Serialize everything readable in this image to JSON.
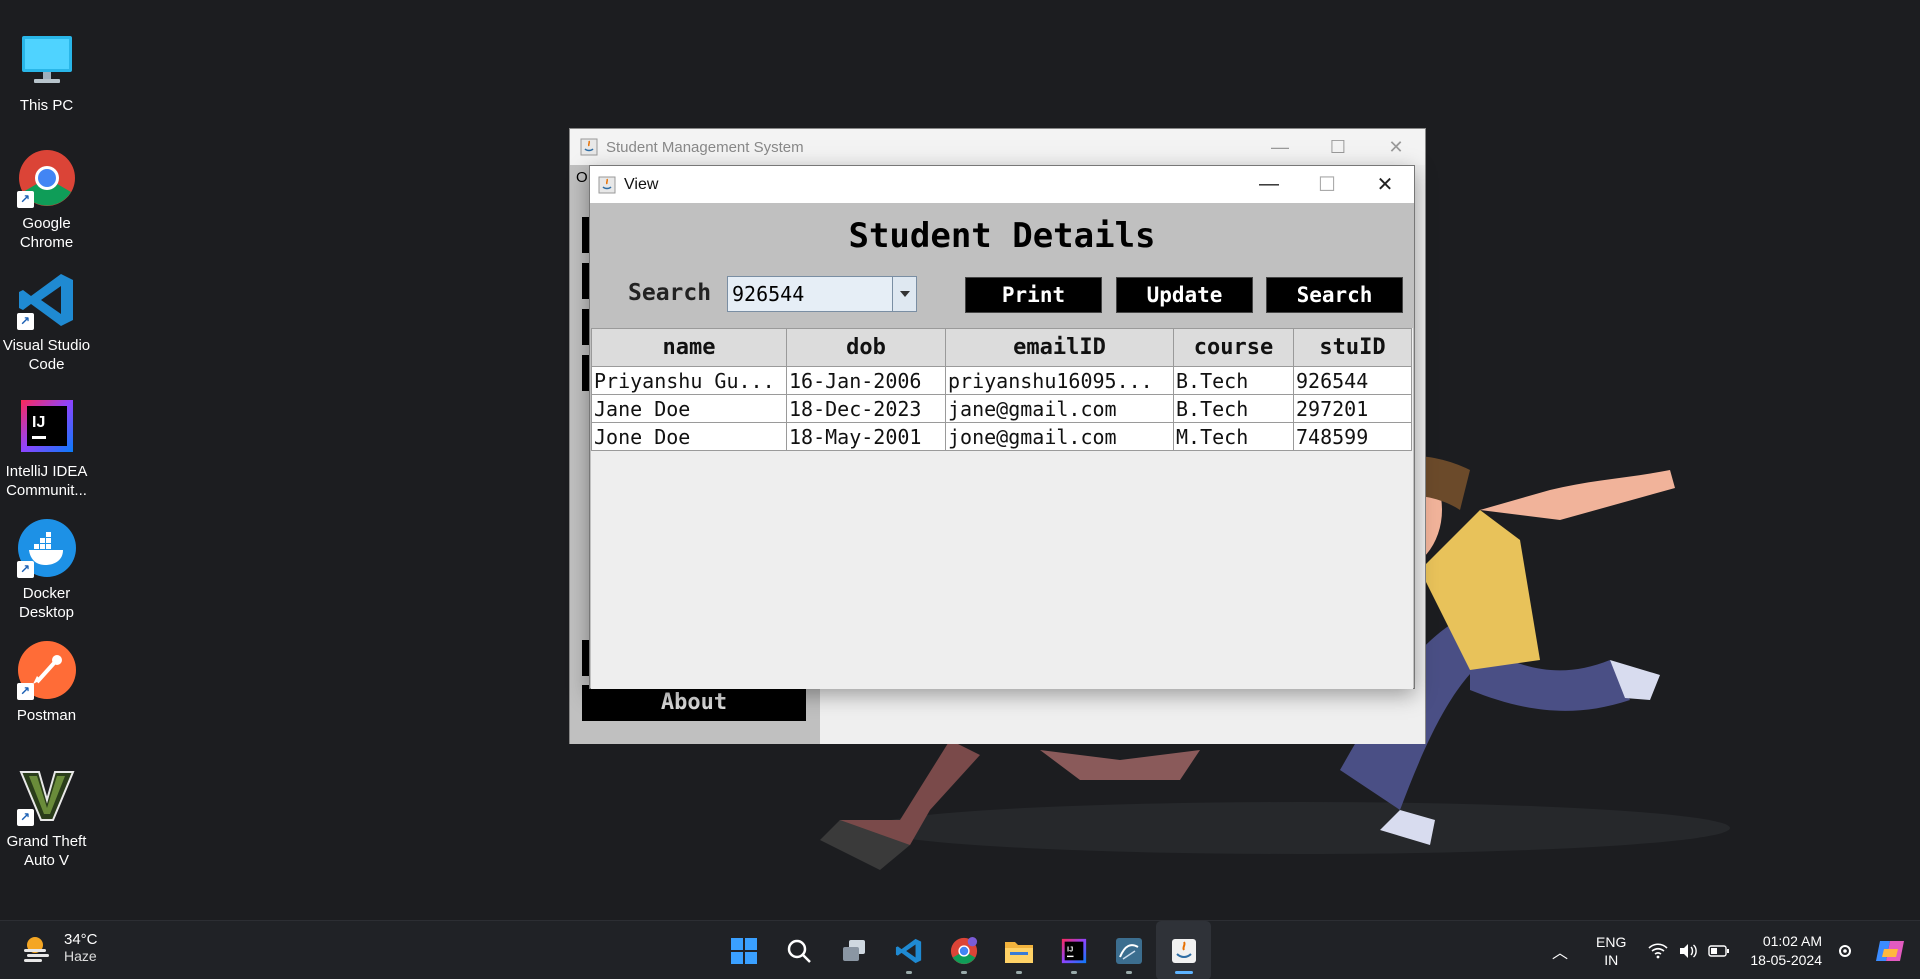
{
  "desktop": {
    "icons": [
      {
        "label": "This PC"
      },
      {
        "label": "Google Chrome"
      },
      {
        "label": "Visual Studio Code"
      },
      {
        "label": "IntelliJ IDEA Communit..."
      },
      {
        "label": "Docker Desktop"
      },
      {
        "label": "Postman"
      },
      {
        "label": "Grand Theft Auto V"
      }
    ]
  },
  "main_window": {
    "title": "Student Management System",
    "menu_first_letter": "O",
    "sidebar_visible_button": "About"
  },
  "view_window": {
    "title": "View",
    "heading": "Student Details",
    "search_label": "Search",
    "search_value": "926544",
    "buttons": {
      "print": "Print",
      "update": "Update",
      "search": "Search"
    },
    "table": {
      "columns": [
        "name",
        "dob",
        "emailID",
        "course",
        "stuID"
      ],
      "rows": [
        [
          "Priyanshu Gu...",
          "16-Jan-2006",
          "priyanshu16095...",
          "B.Tech",
          "926544"
        ],
        [
          "Jane Doe",
          "18-Dec-2023",
          "jane@gmail.com",
          "B.Tech",
          "297201"
        ],
        [
          "Jone Doe",
          "18-May-2001",
          "jone@gmail.com",
          "M.Tech",
          "748599"
        ]
      ]
    }
  },
  "taskbar": {
    "weather": {
      "temp": "34°C",
      "condition": "Haze"
    },
    "pinned": [
      "windows-start",
      "search",
      "task-view",
      "vscode",
      "chrome",
      "file-explorer",
      "intellij",
      "mysql-workbench",
      "java"
    ],
    "language": {
      "line1": "ENG",
      "line2": "IN"
    },
    "clock": {
      "time": "01:02 AM",
      "date": "18-05-2024"
    }
  },
  "colors": {
    "desktop_bg": "#1c1d20",
    "button_bg": "#000000",
    "active_indicator": "#5db3ff"
  }
}
